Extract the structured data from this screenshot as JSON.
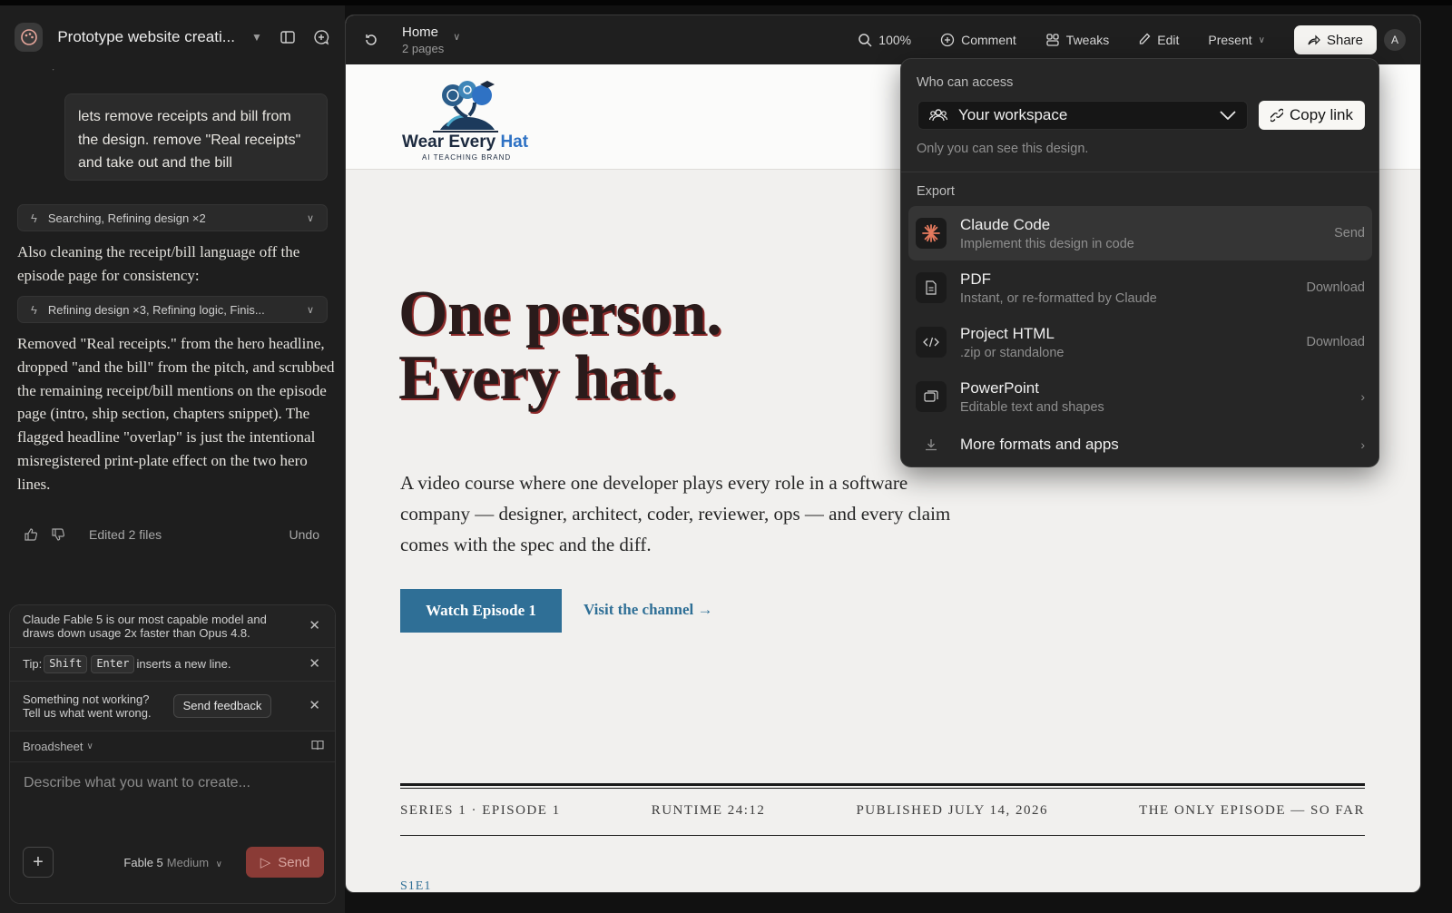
{
  "chat": {
    "project_title": "Prototype website creati...",
    "ghost_status": "Edited 2 files",
    "user_message": "lets remove receipts and bill from the design.   remove \"Real receipts\" and take out and the bill",
    "tool_call_1": "Searching, Refining design ×2",
    "assistant_text_1": "Also cleaning the receipt/bill language off the episode page for consistency:",
    "tool_call_2": "Refining design ×3, Refining logic, Finis...",
    "assistant_text_2": "Removed \"Real receipts.\" from the hero headline, dropped \"and the bill\" from the pitch, and scrubbed the remaining receipt/bill mentions on the episode page (intro, ship section, chapters snippet). The flagged headline \"overlap\" is just the intentional misregistered print-plate effect on the two hero lines.",
    "footer_status": "Edited 2 files",
    "undo_label": "Undo"
  },
  "notices": {
    "model_notice": "Claude Fable 5 is our most capable model and draws down usage 2x faster than Opus 4.8.",
    "tip_prefix": "Tip:",
    "tip_key1": "Shift",
    "tip_key2": "Enter",
    "tip_suffix": "inserts a new line.",
    "feedback_line1": "Something not working?",
    "feedback_line2": "Tell us what went wrong.",
    "feedback_button": "Send feedback"
  },
  "composer": {
    "mode": "Broadsheet",
    "placeholder": "Describe what you want to create...",
    "model_name": "Fable 5",
    "model_level": "Medium",
    "send_label": "Send"
  },
  "toolbar": {
    "page_title": "Home",
    "page_count": "2 pages",
    "zoom": "100%",
    "comment": "Comment",
    "tweaks": "Tweaks",
    "edit": "Edit",
    "present": "Present",
    "share": "Share",
    "avatar_initial": "A"
  },
  "site": {
    "logo_word_main": "Wear Every",
    "logo_word_accent": "Hat",
    "logo_sub": "AI TEACHING BRAND",
    "hero_line1": "One person.",
    "hero_line2": "Every hat.",
    "pitch": "A video course where one developer plays every role in a software company — designer, architect, coder, reviewer, ops — and every claim comes with the spec and the diff.",
    "cta_primary": "Watch Episode 1",
    "cta_secondary": "Visit the channel →",
    "meta": [
      "SERIES 1 · EPISODE 1",
      "RUNTIME 24:12",
      "PUBLISHED JULY 14, 2026",
      "THE ONLY EPISODE — SO FAR"
    ],
    "episode_code": "S1E1"
  },
  "share_menu": {
    "access_label": "Who can access",
    "workspace": "Your workspace",
    "copy_link": "Copy link",
    "visibility_note": "Only you can see this design.",
    "export_label": "Export",
    "exports": [
      {
        "title": "Claude Code",
        "subtitle": "Implement this design in code",
        "action": "Send"
      },
      {
        "title": "PDF",
        "subtitle": "Instant, or re-formatted by Claude",
        "action": "Download"
      },
      {
        "title": "Project HTML",
        "subtitle": ".zip or standalone",
        "action": "Download"
      },
      {
        "title": "PowerPoint",
        "subtitle": "Editable text and shapes",
        "action": "›"
      },
      {
        "title": "More formats and apps",
        "subtitle": "",
        "action": "›"
      }
    ]
  },
  "colors": {
    "accent_blue": "#2f6f96",
    "send_button": "#8a3b36",
    "hero_text": "#2a1b1b",
    "hero_shadow": "#8d2a2a"
  }
}
